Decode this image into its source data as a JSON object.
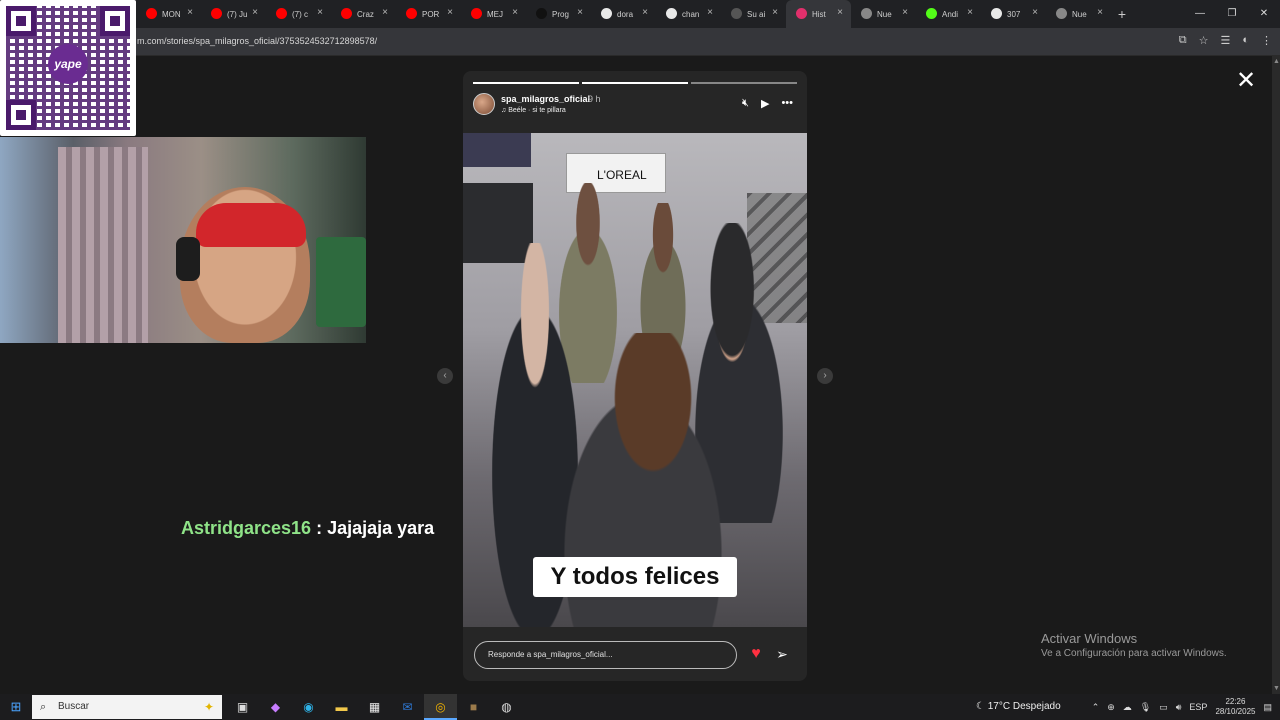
{
  "browser": {
    "tabs": [
      {
        "label": "",
        "color": "#ffffff"
      },
      {
        "label": "MON",
        "color": "#ff0000"
      },
      {
        "label": "(7) Ju",
        "color": "#ff0000"
      },
      {
        "label": "(7) c",
        "color": "#ff0000"
      },
      {
        "label": "Craz",
        "color": "#ff0000"
      },
      {
        "label": "POR",
        "color": "#ff0000"
      },
      {
        "label": "MEJ",
        "color": "#ff0000"
      },
      {
        "label": "Prog",
        "color": "#111111"
      },
      {
        "label": "dora",
        "color": "#e8e8e8"
      },
      {
        "label": "chan",
        "color": "#e8e8e8"
      },
      {
        "label": "Su ai",
        "color": "#555555"
      },
      {
        "label": "Hist",
        "color": "#e1306c"
      },
      {
        "label": "Nue",
        "color": "#888888"
      },
      {
        "label": "Andi",
        "color": "#53fc18"
      },
      {
        "label": "307",
        "color": "#e8e8e8"
      },
      {
        "label": "Nue",
        "color": "#888888"
      }
    ],
    "active_tab_index": 11,
    "url": "m.com/stories/spa_milagros_oficial/3753524532712898578/"
  },
  "story": {
    "username": "spa_milagros_oficial",
    "time": "9 h",
    "music": "Beéle · si te pillara",
    "caption": "Y todos felices",
    "reply_placeholder": "Responde a spa_milagros_oficial...",
    "photo_sign": "L'OREAL"
  },
  "overlay": {
    "qr_logo": "yape",
    "chat_user": "Astridgarces16",
    "chat_sep": " : ",
    "chat_message": "Jajajaja yara"
  },
  "windows_watermark": {
    "line1": "Activar Windows",
    "line2": "Ve a Configuración para activar Windows."
  },
  "taskbar": {
    "search_placeholder": "Buscar",
    "weather": "17°C  Despejado",
    "lang": "ESP",
    "time": "22:26",
    "date": "28/10/2025"
  }
}
